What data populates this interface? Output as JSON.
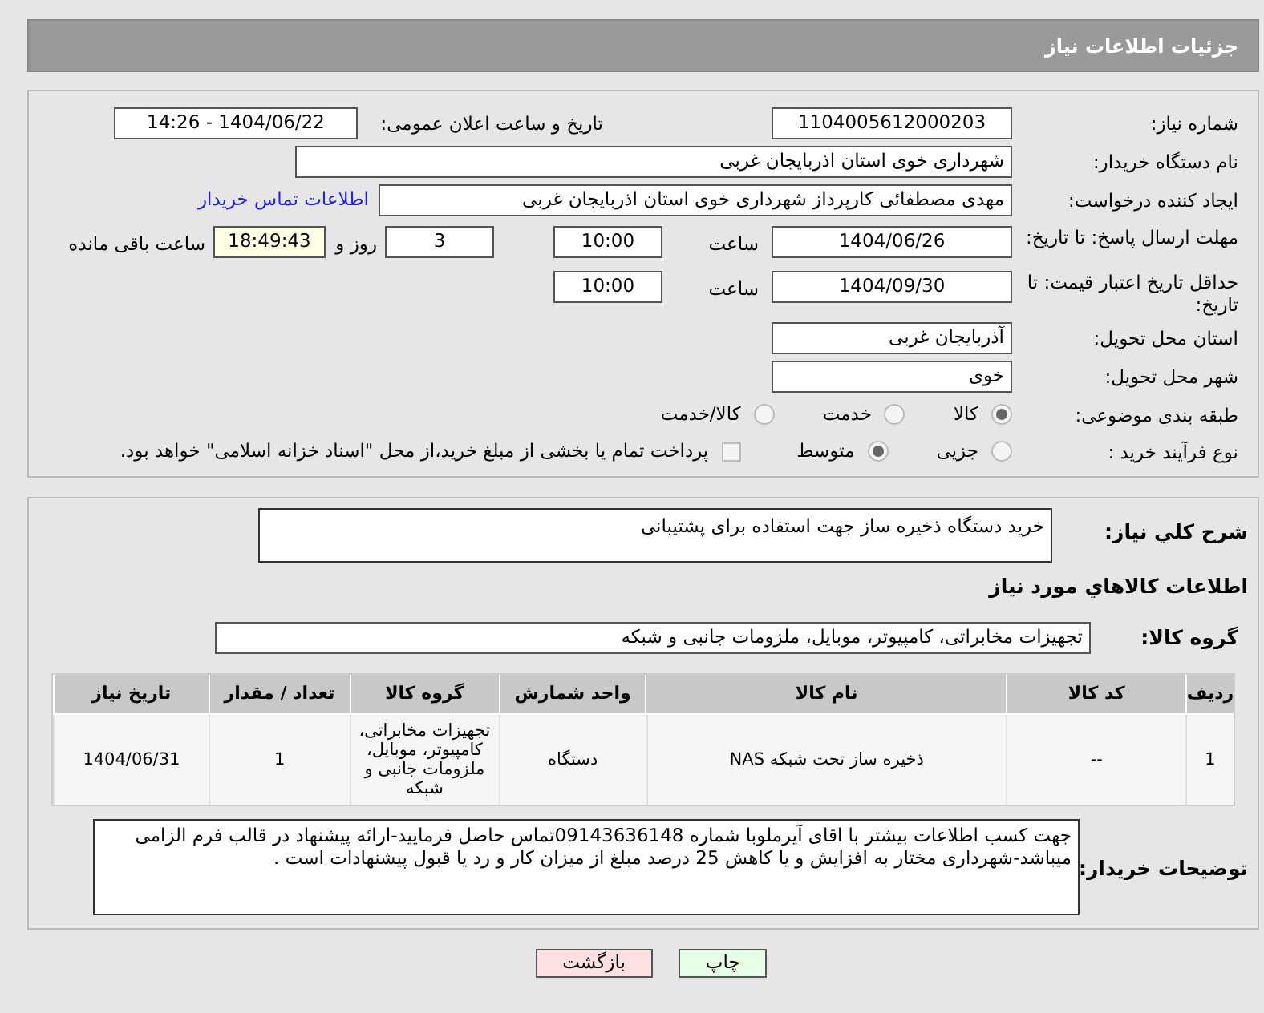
{
  "header": {
    "title": "جزئیات اطلاعات نیاز"
  },
  "need_number": {
    "label": "شماره نیاز:",
    "value": "1104005612000203"
  },
  "announce": {
    "label": "تاریخ و ساعت اعلان عمومی:",
    "value": "1404/06/22 - 14:26"
  },
  "buyer_org": {
    "label": "نام دستگاه خریدار:",
    "value": "شهرداری خوی استان اذربایجان غربی"
  },
  "requester": {
    "label": "ایجاد کننده درخواست:",
    "value": "مهدی مصطفائی کارپرداز شهرداری خوی استان اذربایجان غربی",
    "link": "اطلاعات تماس خریدار"
  },
  "reply_deadline": {
    "label": "مهلت ارسال پاسخ: تا تاریخ:",
    "date": "1404/06/26",
    "time_label": "ساعت",
    "time": "10:00",
    "days": "3",
    "days_label": "روز و",
    "remaining": "18:49:43",
    "remaining_label": "ساعت باقی مانده"
  },
  "price_validity": {
    "label": "حداقل تاریخ اعتبار قیمت: تا تاریخ:",
    "date": "1404/09/30",
    "time_label": "ساعت",
    "time": "10:00"
  },
  "province": {
    "label": "استان محل تحویل:",
    "value": "آذربایجان غربی"
  },
  "city": {
    "label": "شهر محل تحویل:",
    "value": "خوی"
  },
  "category": {
    "label": "طبقه بندی موضوعی:",
    "options": [
      {
        "label": "کالا",
        "selected": true
      },
      {
        "label": "خدمت",
        "selected": false
      },
      {
        "label": "کالا/خدمت",
        "selected": false
      }
    ]
  },
  "process": {
    "label": "نوع فرآیند خرید :",
    "options": [
      {
        "label": "جزیی",
        "selected": false
      },
      {
        "label": "متوسط",
        "selected": true
      }
    ],
    "payment": {
      "label": "پرداخت تمام یا بخشی از مبلغ خرید،از محل \"اسناد خزانه اسلامی\" خواهد بود.",
      "checked": false
    }
  },
  "description": {
    "label": "شرح کلي نياز:",
    "value": "خرید دستگاه ذخیره ساز جهت استفاده برای پشتیبانی"
  },
  "goods_heading": "اطلاعات کالاهاي مورد نياز",
  "goods_group": {
    "label": "گروه کالا:",
    "value": "تجهیزات مخابراتی، کامپیوتر، موبایل، ملزومات جانبی و شبکه"
  },
  "table": {
    "columns": [
      "ردیف",
      "کد کالا",
      "نام کالا",
      "واحد شمارش",
      "گروه کالا",
      "تعداد / مقدار",
      "تاریخ نیاز"
    ],
    "rows": [
      [
        "1",
        "--",
        "ذخیره ساز تحت شبکه NAS",
        "دستگاه",
        "تجهیزات مخابراتی، کامپیوتر، موبایل، ملزومات جانبی و شبکه",
        "1",
        "1404/06/31"
      ]
    ]
  },
  "buyer_notes": {
    "label": "توضیحات خریدار:",
    "value": "جهت کسب اطلاعات بیشتر با اقای آیرملوبا شماره 09143636148تماس حاصل فرمایید-ارائه پیشنهاد در قالب فرم الزامی میباشد-شهرداری مختار به افزایش و یا کاهش 25 درصد مبلغ از میزان کار و رد یا قبول پیشنهادات است ."
  },
  "buttons": [
    {
      "label": "چاپ",
      "kind": "print"
    },
    {
      "label": "بازگشت",
      "kind": "back"
    }
  ]
}
